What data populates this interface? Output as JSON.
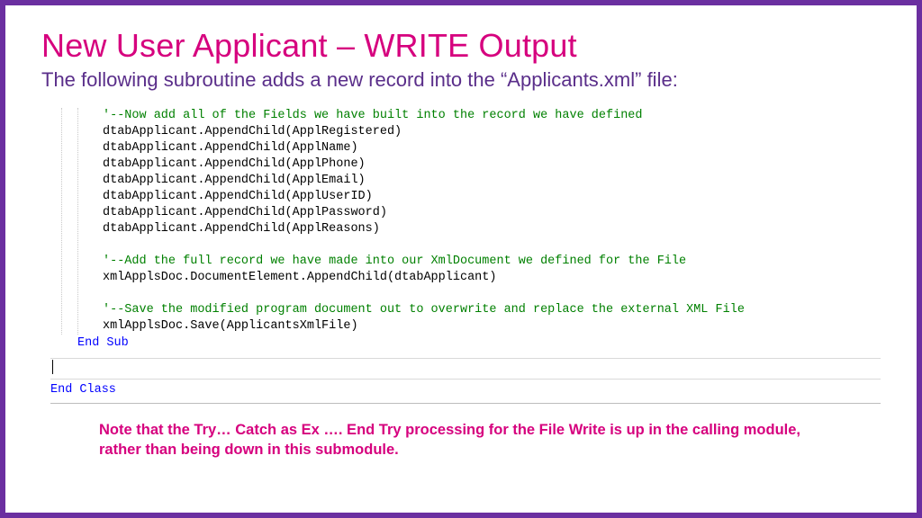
{
  "title": "New User Applicant – WRITE Output",
  "subtitle": "The following subroutine adds a new record into the “Applicants.xml” file:",
  "code": {
    "comment1": "'--Now add all of the Fields we have built into the record we have defined",
    "l1": "dtabApplicant.AppendChild(ApplRegistered)",
    "l2": "dtabApplicant.AppendChild(ApplName)",
    "l3": "dtabApplicant.AppendChild(ApplPhone)",
    "l4": "dtabApplicant.AppendChild(ApplEmail)",
    "l5": "dtabApplicant.AppendChild(ApplUserID)",
    "l6": "dtabApplicant.AppendChild(ApplPassword)",
    "l7": "dtabApplicant.AppendChild(ApplReasons)",
    "comment2": "'--Add the full record we have made into our XmlDocument we defined for the File",
    "l8": "xmlApplsDoc.DocumentElement.AppendChild(dtabApplicant)",
    "comment3": "'--Save the modified program document out to overwrite and replace the external XML File",
    "l9": "xmlApplsDoc.Save(ApplicantsXmlFile)",
    "endsub": "End Sub",
    "endclass": "End Class"
  },
  "note": "Note that the Try… Catch as Ex …. End Try processing for the File Write is up in the calling module, rather than being down in this submodule."
}
